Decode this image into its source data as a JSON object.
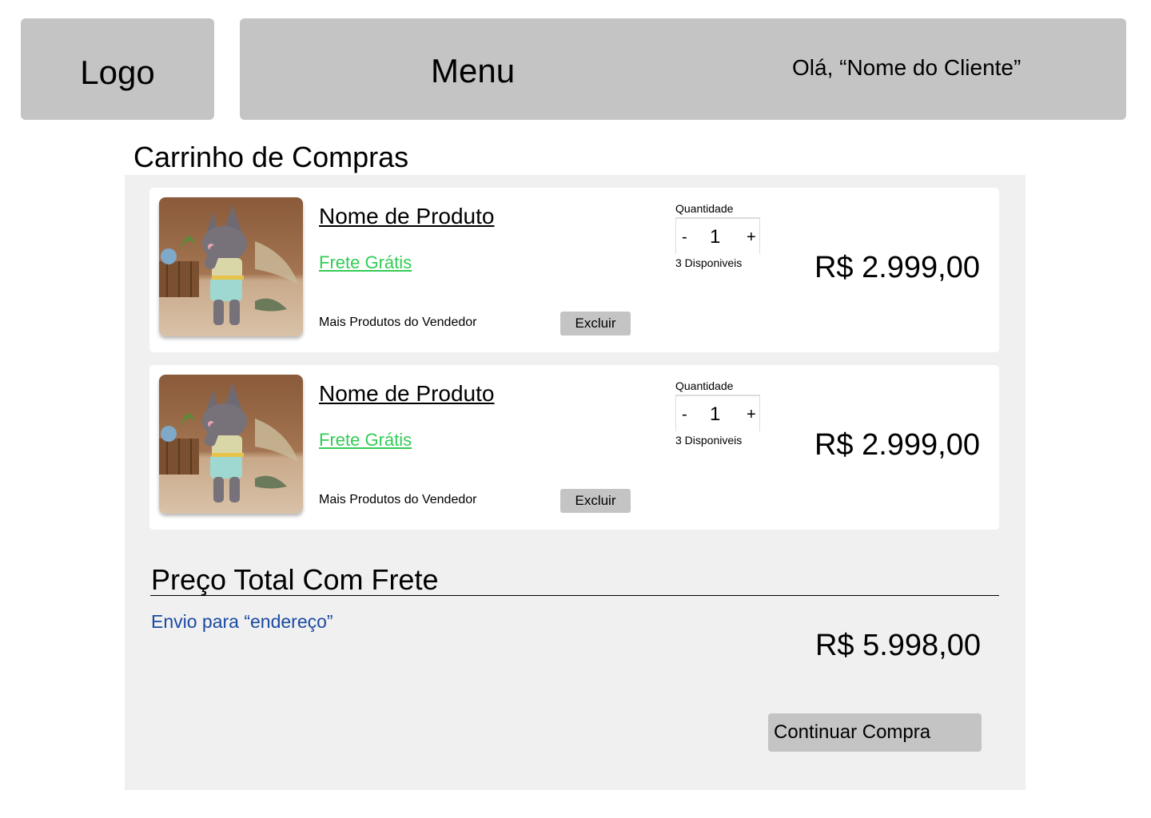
{
  "header": {
    "logo_label": "Logo",
    "menu_label": "Menu",
    "greeting": "Olá, “Nome do Cliente”"
  },
  "page": {
    "title": "Carrinho de Compras"
  },
  "cart": {
    "items": [
      {
        "name": "Nome de Produto",
        "shipping": "Frete Grátis",
        "seller_link": "Mais Produtos do Vendedor",
        "delete_label": "Excluir",
        "quantity_label": "Quantidade",
        "quantity_minus": "-",
        "quantity": "1",
        "quantity_plus": "+",
        "available": "3 Disponiveis",
        "price": "R$ 2.999,00"
      },
      {
        "name": "Nome de Produto",
        "shipping": "Frete Grátis",
        "seller_link": "Mais Produtos do Vendedor",
        "delete_label": "Excluir",
        "quantity_label": "Quantidade",
        "quantity_minus": "-",
        "quantity": "1",
        "quantity_plus": "+",
        "available": "3 Disponiveis",
        "price": "R$ 2.999,00"
      }
    ]
  },
  "summary": {
    "title": "Preço Total Com Frete",
    "address": "Envio para “endereço”",
    "total": "R$ 5.998,00",
    "continue_label": "Continuar Compra"
  },
  "colors": {
    "placeholder_gray": "#c4c4c4",
    "panel_background": "#f0f0f0",
    "free_shipping_green": "#33cc55",
    "address_blue": "#1a4aa0"
  }
}
